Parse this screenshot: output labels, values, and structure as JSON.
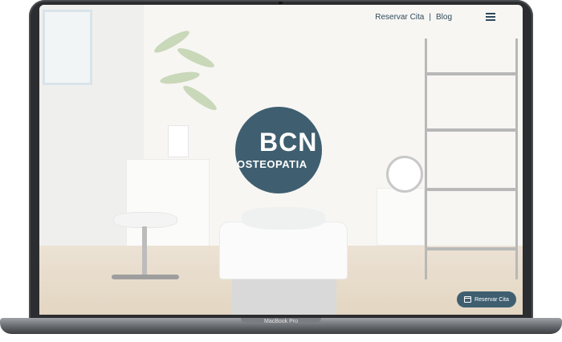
{
  "nav": {
    "reservar": "Reservar Cita",
    "separator": "|",
    "blog": "Blog",
    "menu_icon": "hamburger-menu-icon"
  },
  "logo": {
    "line1": "BCN",
    "line2": "OSTEOPATIA"
  },
  "cta": {
    "label": "Reservar Cita",
    "icon": "calendar-icon"
  },
  "device": {
    "label": "MacBook Pro"
  },
  "colors": {
    "brand": "#3f5f70",
    "nav_text": "#2f4a5b"
  }
}
